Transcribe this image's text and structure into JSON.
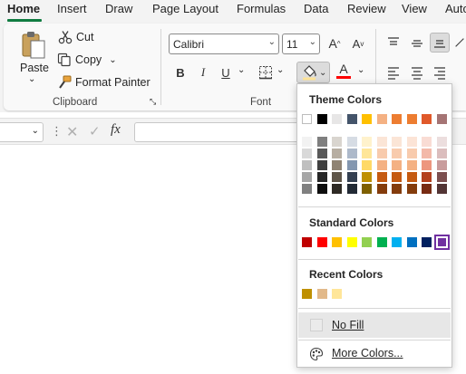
{
  "tabs": [
    "Home",
    "Insert",
    "Draw",
    "Page Layout",
    "Formulas",
    "Data",
    "Review",
    "View",
    "Auto"
  ],
  "clipboard": {
    "paste": "Paste",
    "cut": "Cut",
    "copy": "Copy",
    "format_painter": "Format Painter",
    "group_label": "Clipboard"
  },
  "font": {
    "name": "Calibri",
    "size": "11",
    "bold": "B",
    "italic": "I",
    "underline": "U",
    "font_color_letter": "A",
    "group_label": "Font",
    "font_color": "#ff0000"
  },
  "formula_bar": {
    "fx": "fx"
  },
  "fill_menu": {
    "theme_heading": "Theme Colors",
    "standard_heading": "Standard Colors",
    "recent_heading": "Recent Colors",
    "no_fill": "No Fill",
    "more_colors": "More Colors...",
    "theme_top": [
      "#ffffff",
      "#000000",
      "#e7e6e6",
      "#44546a",
      "#ffc000",
      "#f4b183",
      "#ed7d31",
      "#ed7d31",
      "#e0592a",
      "#a57474"
    ],
    "theme_shades": [
      [
        "#f2f2f2",
        "#d9d9d9",
        "#bfbfbf",
        "#a6a6a6",
        "#808080"
      ],
      [
        "#7f7f7f",
        "#595959",
        "#404040",
        "#262626",
        "#0d0d0d"
      ],
      [
        "#d9d5cf",
        "#b7aea2",
        "#8f8373",
        "#5e5548",
        "#2e2a24"
      ],
      [
        "#d6dce4",
        "#adb9ca",
        "#8497b0",
        "#333f50",
        "#222a35"
      ],
      [
        "#fff2cc",
        "#ffe699",
        "#ffd966",
        "#bf9000",
        "#7f6000"
      ],
      [
        "#fbe5d6",
        "#f8cbad",
        "#f4b183",
        "#c55a11",
        "#843c0c"
      ],
      [
        "#fbe5d6",
        "#f8cbad",
        "#f4b183",
        "#c55a11",
        "#843c0c"
      ],
      [
        "#fce4d6",
        "#f8cbad",
        "#f4b183",
        "#c55a11",
        "#843c0c"
      ],
      [
        "#f9dcd4",
        "#f3b9a9",
        "#ed967e",
        "#b4401d",
        "#782b13"
      ],
      [
        "#ecdede",
        "#dbbdbd",
        "#c99c9c",
        "#7c4f4f",
        "#533535"
      ]
    ],
    "standard": [
      "#c00000",
      "#ff0000",
      "#ffc000",
      "#ffff00",
      "#92d050",
      "#00b050",
      "#00b0f0",
      "#0070c0",
      "#002060",
      "#7030a0"
    ],
    "recent": [
      "#bf9000",
      "#e2b98a",
      "#ffe699"
    ]
  },
  "colors": {
    "accent_green": "#107c41",
    "selected_outline": "#7030a0"
  }
}
